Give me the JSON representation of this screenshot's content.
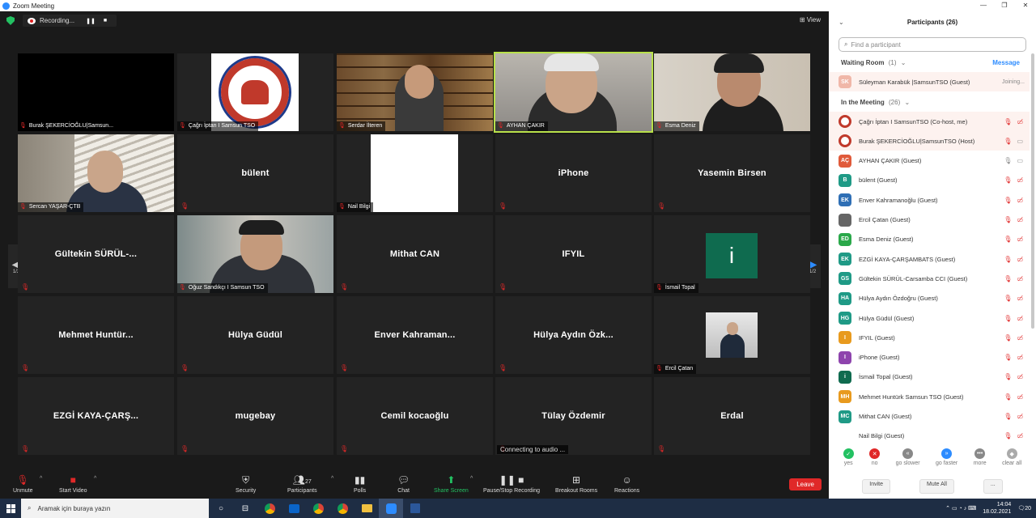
{
  "window": {
    "title": "Zoom Meeting",
    "min": "—",
    "restore": "❐",
    "close": "✕"
  },
  "topbar": {
    "recording": "Recording...",
    "pause": "❚❚",
    "stop": "■",
    "view": "View"
  },
  "tiles": [
    {
      "label": "Burak ŞEKERCİOĞLU|Samsun...",
      "kind": "black"
    },
    {
      "label": "Çağrı İptan I Samsun TSO",
      "kind": "logo"
    },
    {
      "label": "Serdar İlteren",
      "kind": "video-books"
    },
    {
      "label": "AYHAN ÇAKIR",
      "kind": "video-man",
      "active": true
    },
    {
      "label": "Esma Deniz",
      "kind": "video-woman"
    },
    {
      "label": "Sercan YAŞAR-ÇTB",
      "kind": "video-young"
    },
    {
      "name": "bülent",
      "kind": "name"
    },
    {
      "label": "Nail Bilgi",
      "kind": "white"
    },
    {
      "name": "iPhone",
      "kind": "name"
    },
    {
      "name": "Yasemin Birsen",
      "kind": "name"
    },
    {
      "name": "Gültekin  SÜRÜL-...",
      "kind": "name"
    },
    {
      "label": "Oğuz Sandıkçı I Samsun TSO",
      "kind": "video-office"
    },
    {
      "name": "Mithat CAN",
      "kind": "name"
    },
    {
      "name": "IFYIL",
      "kind": "name"
    },
    {
      "label": "İsmail Topal",
      "kind": "avatar-i"
    },
    {
      "name": "Mehmet  Huntür...",
      "kind": "name"
    },
    {
      "name": "Hülya Güdül",
      "kind": "name"
    },
    {
      "name": "Enver  Kahraman...",
      "kind": "name"
    },
    {
      "name": "Hülya Aydın Özk...",
      "kind": "name"
    },
    {
      "label": "Ercil Çatan",
      "kind": "small-video"
    },
    {
      "name": "EZGİ  KAYA-ÇARŞ...",
      "kind": "name"
    },
    {
      "name": "mugebay",
      "kind": "name"
    },
    {
      "name": "Cemil kocaoğlu",
      "kind": "name"
    },
    {
      "name": "Tülay Özdemir",
      "kind": "name",
      "status": "Connecting to audio ..."
    },
    {
      "name": "Erdal",
      "kind": "name"
    }
  ],
  "avatar_i_letter": "i",
  "pager": {
    "left": "1/2",
    "right": "1/2"
  },
  "toolbar": {
    "unmute": "Unmute",
    "start_video": "Start Video",
    "security": "Security",
    "participants": "Participants",
    "participant_count": "27",
    "polls": "Polls",
    "chat": "Chat",
    "share": "Share Screen",
    "record": "Pause/Stop Recording",
    "breakout": "Breakout Rooms",
    "reactions": "Reactions",
    "leave": "Leave"
  },
  "panel": {
    "title": "Participants (26)",
    "search_placeholder": "Find a participant",
    "waiting_room": "Waiting Room",
    "waiting_count": "(1)",
    "message": "Message",
    "in_meeting": "In the Meeting",
    "in_meeting_count": "(26)",
    "waiting": [
      {
        "initials": "SK",
        "name": "Süleyman Karabük |SamsunTSO (Guest)",
        "status": "Joining...",
        "color": "#f0b7a8"
      }
    ],
    "people": [
      {
        "initials": "",
        "name": "Çağrı İptan I SamsunTSO (Co-host, me)",
        "color": "#c0392b",
        "logo": true
      },
      {
        "initials": "",
        "name": "Burak ŞEKERCİOĞLU|SamsunTSO (Host)",
        "color": "#c0392b",
        "logo": true
      },
      {
        "initials": "AÇ",
        "name": "AYHAN ÇAKIR (Guest)",
        "color": "#e05a3a"
      },
      {
        "initials": "B",
        "name": "bülent (Guest)",
        "color": "#1f9a86"
      },
      {
        "initials": "EK",
        "name": "Enver Kahramanoğlu (Guest)",
        "color": "#2f6fb5"
      },
      {
        "initials": "",
        "name": "Ercil Çatan (Guest)",
        "color": "#666666"
      },
      {
        "initials": "ED",
        "name": "Esma Deniz (Guest)",
        "color": "#2aa84a"
      },
      {
        "initials": "EK",
        "name": "EZGİ KAYA-ÇARŞAMBATS (Guest)",
        "color": "#1f9a86"
      },
      {
        "initials": "GS",
        "name": "Gültekin SÜRÜL-Carsamba CCI (Guest)",
        "color": "#1f9a86"
      },
      {
        "initials": "HA",
        "name": "Hülya Aydın Özdoğru (Guest)",
        "color": "#1f9a86"
      },
      {
        "initials": "HG",
        "name": "Hülya Güdül (Guest)",
        "color": "#1f9a86"
      },
      {
        "initials": "I",
        "name": "IFYIL (Guest)",
        "color": "#e89a1e"
      },
      {
        "initials": "I",
        "name": "iPhone (Guest)",
        "color": "#8e44ad"
      },
      {
        "initials": "i",
        "name": "İsmail Topal (Guest)",
        "color": "#0f6b4f"
      },
      {
        "initials": "MH",
        "name": "Mehmet Huntürk Samsun TSO (Guest)",
        "color": "#e89a1e"
      },
      {
        "initials": "MC",
        "name": "Mithat CAN (Guest)",
        "color": "#1f9a86"
      },
      {
        "initials": "",
        "name": "Nail Bilgi (Guest)",
        "color": "#ffffff"
      }
    ],
    "reactions": [
      {
        "label": "yes",
        "sym": "✓",
        "color": "#23c162"
      },
      {
        "label": "no",
        "sym": "✕",
        "color": "#e02828"
      },
      {
        "label": "go slower",
        "sym": "«",
        "color": "#888888"
      },
      {
        "label": "go faster",
        "sym": "»",
        "color": "#2d8cff"
      },
      {
        "label": "more",
        "sym": "•••",
        "color": "#888888"
      },
      {
        "label": "clear all",
        "sym": "◆",
        "color": "#aaaaaa"
      }
    ],
    "invite": "Invite",
    "mute_all": "Mute All",
    "more": "..."
  },
  "taskbar": {
    "search": "Aramak için buraya yazın",
    "time": "14:04",
    "date": "18.02.2021",
    "notif": "20"
  }
}
